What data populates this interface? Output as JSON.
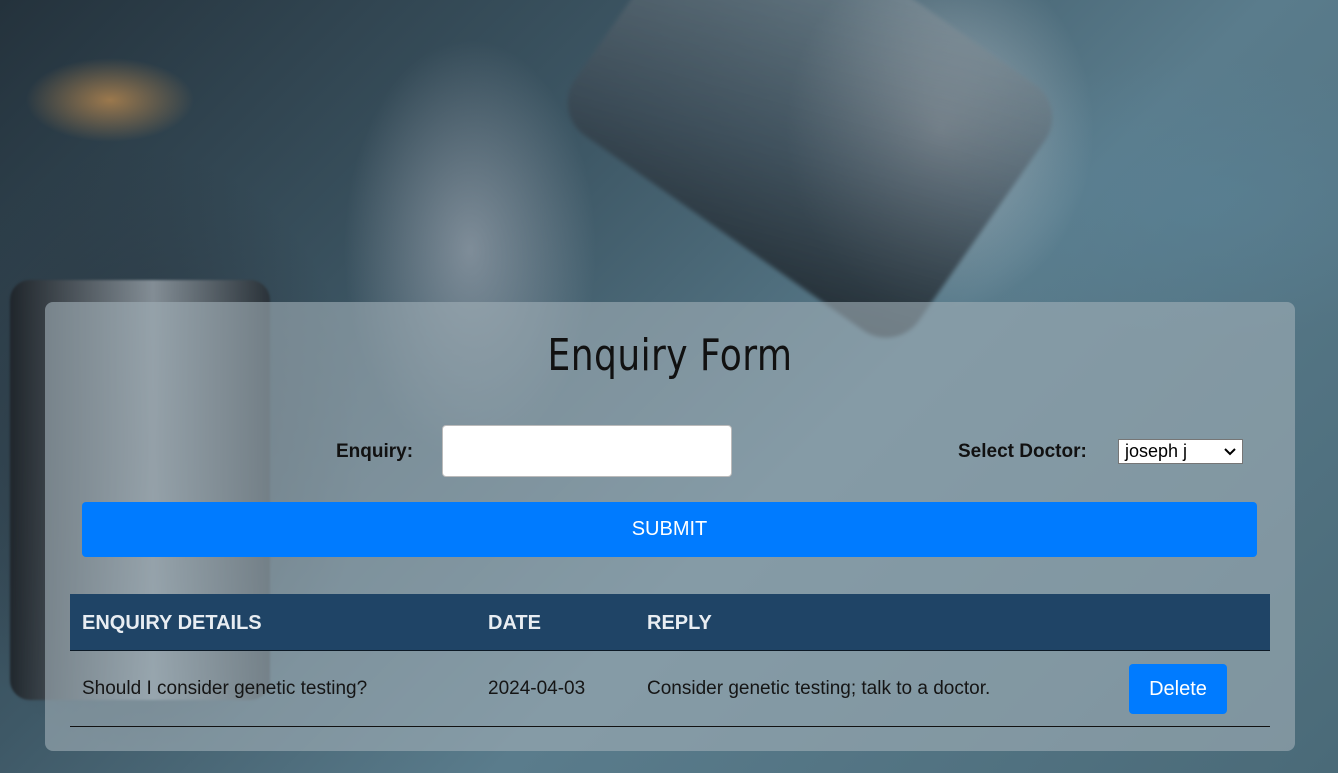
{
  "form": {
    "title": "Enquiry Form",
    "enquiry_label": "Enquiry:",
    "enquiry_value": "",
    "doctor_label": "Select Doctor:",
    "doctor_selected": "joseph j",
    "submit_label": "SUBMIT"
  },
  "table": {
    "headers": [
      "ENQUIRY DETAILS",
      "DATE",
      "REPLY"
    ],
    "rows": [
      {
        "details": "Should I consider genetic testing?",
        "date": "2024-04-03",
        "reply": "Consider genetic testing; talk to a doctor.",
        "action": "Delete"
      }
    ]
  },
  "colors": {
    "accent": "#007bff",
    "header_bg": "#1f4466"
  },
  "icons": {
    "select_arrow": "chevron-down-icon"
  }
}
